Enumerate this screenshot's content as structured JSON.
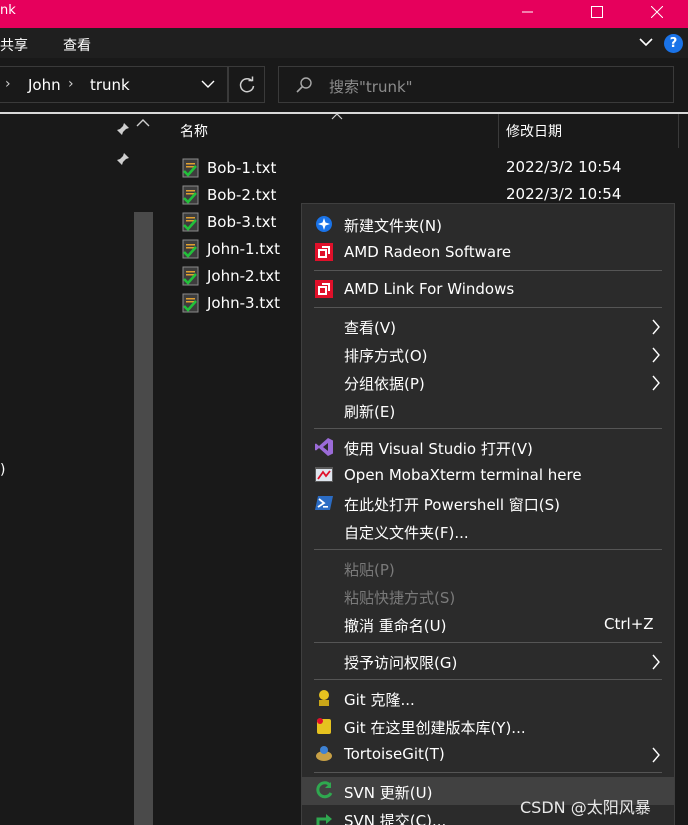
{
  "window": {
    "title_fragment": "nk",
    "titlebar_color": "#e6005c"
  },
  "ribbon": {
    "tabs": [
      "共享",
      "查看"
    ],
    "help_label": "?"
  },
  "address": {
    "crumbs": [
      "John",
      "trunk"
    ],
    "search_placeholder": "搜索\"trunk\""
  },
  "nav": {
    "partial_text": ")"
  },
  "columns": {
    "name": "名称",
    "modified": "修改日期"
  },
  "files": [
    {
      "name": "Bob-1.txt",
      "date": "2022/3/2 10:54"
    },
    {
      "name": "Bob-2.txt",
      "date": "2022/3/2 10:54"
    },
    {
      "name": "Bob-3.txt",
      "date": ""
    },
    {
      "name": "John-1.txt",
      "date": ""
    },
    {
      "name": "John-2.txt",
      "date": ""
    },
    {
      "name": "John-3.txt",
      "date": ""
    }
  ],
  "context_menu": {
    "items": [
      {
        "label": "新建文件夹(N)",
        "icon": "new-folder-icon"
      },
      {
        "label": "AMD Radeon Software",
        "icon": "amd-icon"
      },
      {
        "label": "AMD Link For Windows",
        "icon": "amd-icon"
      },
      {
        "label": "查看(V)",
        "submenu": true
      },
      {
        "label": "排序方式(O)",
        "submenu": true
      },
      {
        "label": "分组依据(P)",
        "submenu": true
      },
      {
        "label": "刷新(E)"
      },
      {
        "label": "使用 Visual Studio 打开(V)",
        "icon": "visual-studio-icon"
      },
      {
        "label": "Open MobaXterm terminal here",
        "icon": "mobaxterm-icon"
      },
      {
        "label": "在此处打开 Powershell 窗口(S)",
        "icon": "powershell-icon"
      },
      {
        "label": "自定义文件夹(F)..."
      },
      {
        "label": "粘贴(P)",
        "disabled": true
      },
      {
        "label": "粘贴快捷方式(S)",
        "disabled": true
      },
      {
        "label": "撤消 重命名(U)",
        "shortcut": "Ctrl+Z"
      },
      {
        "label": "授予访问权限(G)",
        "submenu": true
      },
      {
        "label": "Git 克隆...",
        "icon": "git-clone-icon"
      },
      {
        "label": "Git 在这里创建版本库(Y)...",
        "icon": "git-init-icon"
      },
      {
        "label": "TortoiseGit(T)",
        "icon": "tortoisegit-icon",
        "submenu": true
      },
      {
        "label": "SVN 更新(U)",
        "icon": "svn-update-icon"
      },
      {
        "label": "SVN 提交(C)...",
        "icon": "svn-commit-icon"
      }
    ]
  },
  "watermark": "CSDN @太阳风暴"
}
